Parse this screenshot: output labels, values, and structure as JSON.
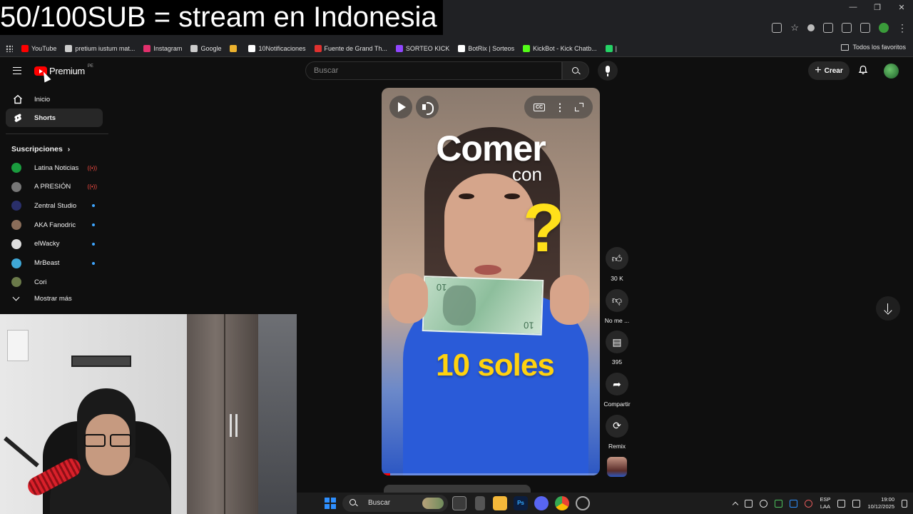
{
  "stream_overlay": {
    "text": "50/100SUB  = stream en Indonesia"
  },
  "bookmarks": [
    {
      "label": "YouTube",
      "icon": "youtube-icon",
      "color": "#ff0000"
    },
    {
      "label": "pretium iustum mat...",
      "icon": "globe-icon",
      "color": "#cccccc"
    },
    {
      "label": "Instagram",
      "icon": "instagram-icon",
      "color": "#e1306c"
    },
    {
      "label": "Google",
      "icon": "google-icon",
      "color": "#cccccc"
    },
    {
      "label": "",
      "icon": "slack-icon",
      "color": "#ecb22e"
    },
    {
      "label": "10Notificaciones",
      "icon": "x-icon",
      "color": "#ffffff"
    },
    {
      "label": "Fuente de Grand Th...",
      "icon": "font-icon",
      "color": "#e0312f"
    },
    {
      "label": "SORTEO KICK",
      "icon": "kick-icon",
      "color": "#9146ff"
    },
    {
      "label": "BotRix | Sorteos",
      "icon": "botrix-icon",
      "color": "#ffffff"
    },
    {
      "label": "KickBot - Kick Chatb...",
      "icon": "kickbot-icon",
      "color": "#53fc18"
    },
    {
      "label": "|",
      "icon": "whatsapp-icon",
      "color": "#25d366"
    }
  ],
  "bookmarks_all": "Todos los favoritos",
  "youtube": {
    "brand": "Premium",
    "region": "PE",
    "search_placeholder": "Buscar",
    "create_label": "Crear"
  },
  "sidebar": {
    "items": [
      {
        "label": "Inicio",
        "icon": "home-icon"
      },
      {
        "label": "Shorts",
        "icon": "shorts-icon",
        "active": true
      }
    ],
    "subscriptions_heading": "Suscripciones",
    "subscriptions": [
      {
        "name": "Latina Noticias",
        "status": "live",
        "avatar_color": "#1a9c3e"
      },
      {
        "name": "A PRESIÓN",
        "status": "live",
        "avatar_color": "#777777"
      },
      {
        "name": "Zentral Studio",
        "status": "new",
        "avatar_color": "#2a2f6a"
      },
      {
        "name": "AKA Fanodric",
        "status": "new",
        "avatar_color": "#8a6d5a"
      },
      {
        "name": "elWacky",
        "status": "new",
        "avatar_color": "#dddddd"
      },
      {
        "name": "MrBeast",
        "status": "new",
        "avatar_color": "#3fa7d6"
      },
      {
        "name": "Cori",
        "status": "none",
        "avatar_color": "#6b7a4a"
      }
    ],
    "live_symbol": "((•))",
    "show_more": "Mostrar más"
  },
  "short": {
    "overlay_line1": "Comer",
    "overlay_line2": "con",
    "overlay_question": "?",
    "overlay_amount": "10 soles",
    "bill_number": "10",
    "progress": 0.04,
    "cc_label": "CC",
    "actions": [
      {
        "name": "like",
        "icon": "thumbs-up-icon",
        "glyph": "👍︎",
        "label": "30 K"
      },
      {
        "name": "dislike",
        "icon": "thumbs-down-icon",
        "glyph": "👎︎",
        "label": "No me ..."
      },
      {
        "name": "comments",
        "icon": "comment-icon",
        "glyph": "▤",
        "label": "395"
      },
      {
        "name": "share",
        "icon": "share-icon",
        "glyph": "➦",
        "label": "Compartir"
      },
      {
        "name": "remix",
        "icon": "remix-icon",
        "glyph": "⟳",
        "label": "Remix"
      }
    ]
  },
  "taskbar": {
    "search_label": "Buscar",
    "lang_top": "ESP",
    "lang_bottom": "LAA",
    "time": "19:00",
    "date": "10/12/2025"
  }
}
